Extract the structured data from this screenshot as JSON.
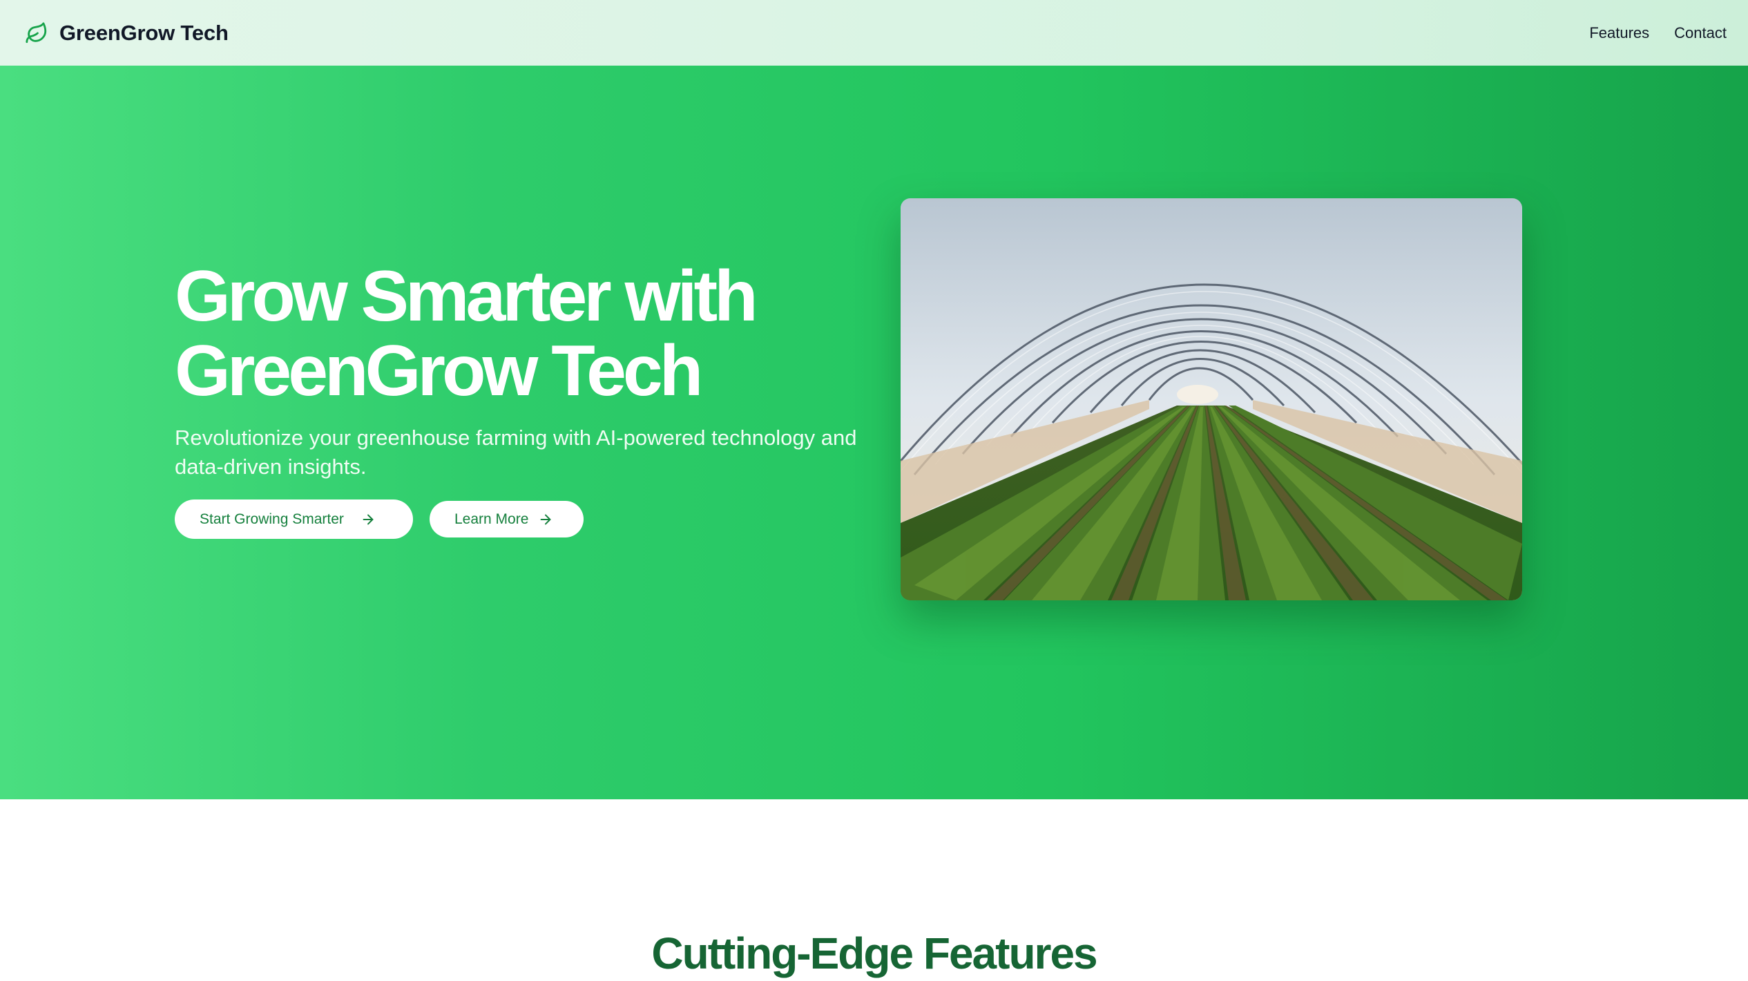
{
  "header": {
    "brand_name": "GreenGrow Tech",
    "brand_icon": "leaf-icon",
    "nav": [
      {
        "label": "Features"
      },
      {
        "label": "Contact"
      }
    ]
  },
  "hero": {
    "title_line1": "Grow Smarter with",
    "title_line2": "GreenGrow Tech",
    "subtitle": "Revolutionize your greenhouse farming with AI-powered technology and data-driven insights.",
    "primary_cta": "Start Growing Smarter",
    "secondary_cta": "Learn More",
    "cta_icon": "arrow-right-icon",
    "image_subject": "greenhouse-tunnel-photo"
  },
  "features": {
    "heading": "Cutting-Edge Features"
  },
  "colors": {
    "hero_gradient_start": "#4ade80",
    "hero_gradient_end": "#16a34a",
    "accent": "#15803d",
    "features_heading": "#166534",
    "topbar_bg": "#e3f6ea"
  }
}
